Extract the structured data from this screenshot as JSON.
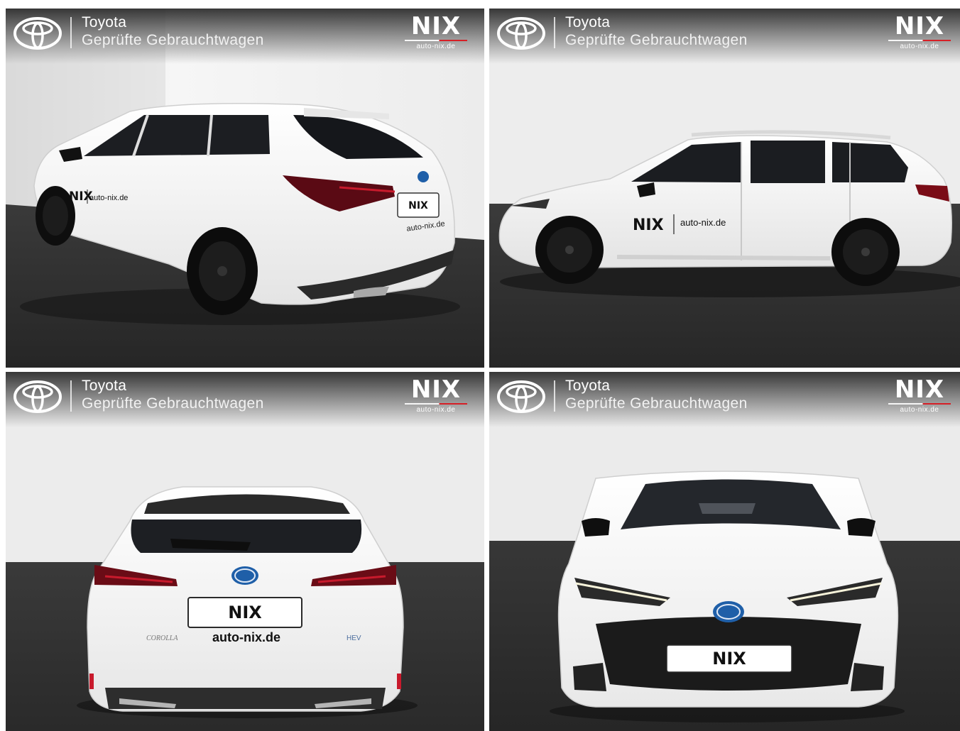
{
  "brand_header": {
    "brand": "Toyota",
    "subtitle": "Geprüfte Gebrauchtwagen",
    "dealer_logo": "NIX",
    "dealer_url": "auto-nix.de"
  },
  "decals": {
    "door_logo": "NIX",
    "door_url": "auto-nix.de",
    "plate_text": "NIX",
    "rear_url": "auto-nix.de",
    "model_badge": "COROLLA",
    "hybrid_badge": "HEV"
  },
  "photos": [
    {
      "view": "rear three-quarter"
    },
    {
      "view": "side profile"
    },
    {
      "view": "rear"
    },
    {
      "view": "front"
    }
  ],
  "colors": {
    "car_body": "#f7f7f5",
    "floor": "#2e2e2e",
    "wall": "#eeeeee",
    "accent_red": "#d61f26",
    "toyota_blue": "#1f5fa8"
  }
}
